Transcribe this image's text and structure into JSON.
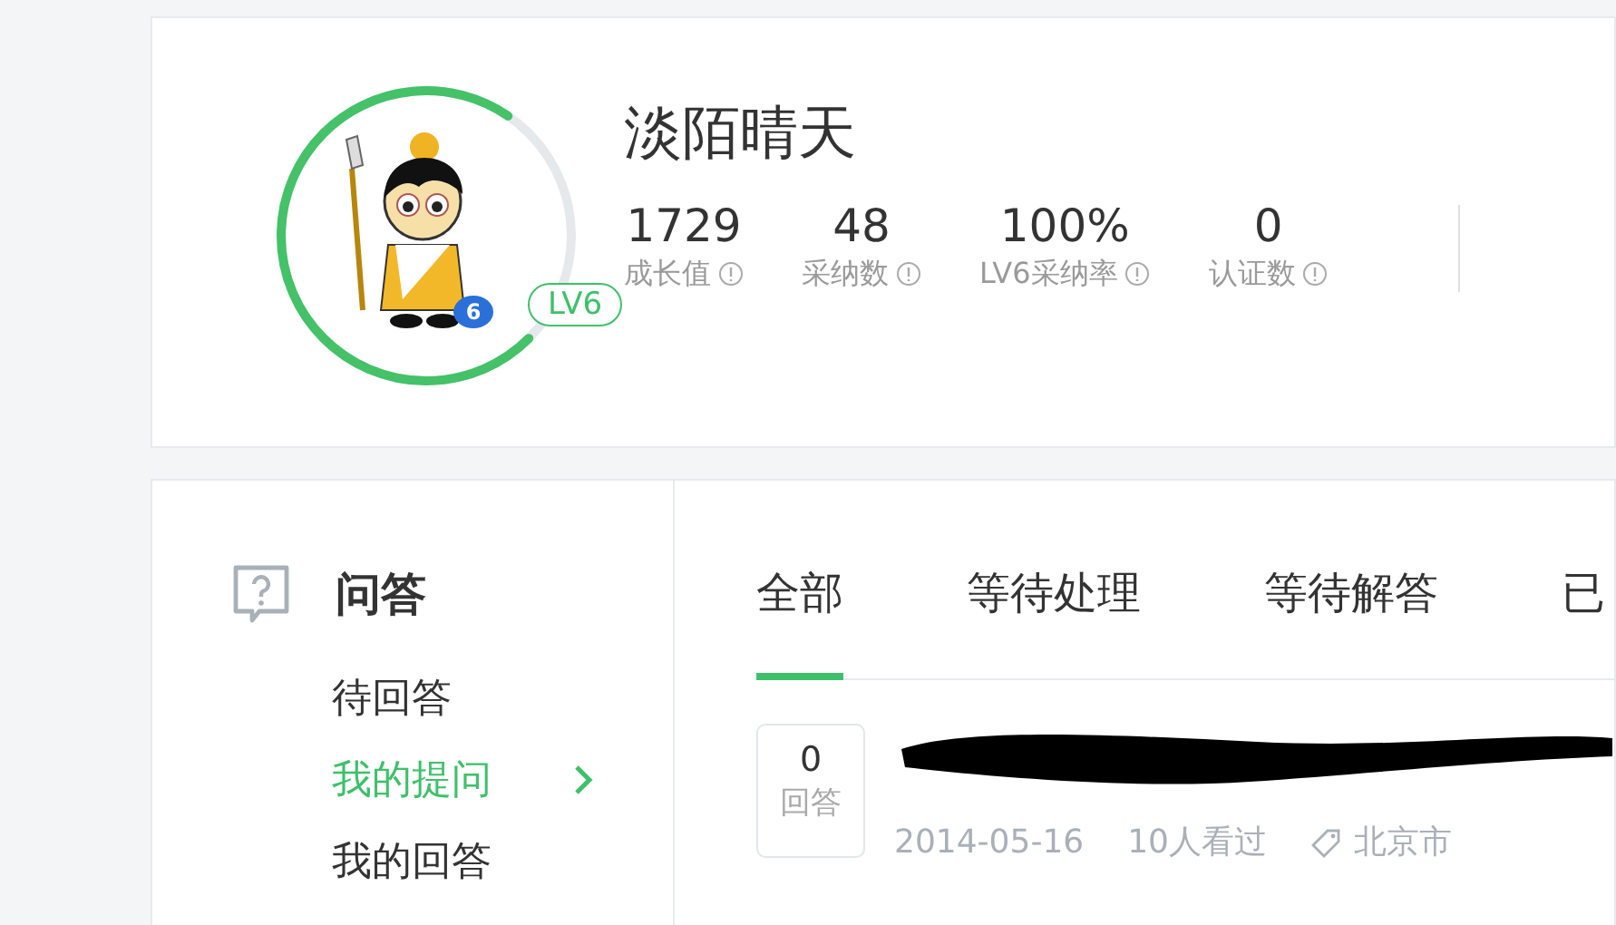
{
  "profile": {
    "name": "淡陌晴天",
    "level_badge": "LV6",
    "avatar_badge": "6",
    "growth_ring": {
      "level": 0.72
    },
    "stats": [
      {
        "value": "1729",
        "label": "成长值"
      },
      {
        "value": "48",
        "label": "采纳数"
      },
      {
        "value": "100%",
        "label": "LV6采纳率"
      },
      {
        "value": "0",
        "label": "认证数"
      }
    ]
  },
  "sidebar": {
    "title": "问答",
    "items": [
      {
        "label": "待回答",
        "selected": false
      },
      {
        "label": "我的提问",
        "selected": true
      },
      {
        "label": "我的回答",
        "selected": false
      }
    ]
  },
  "tabs": [
    {
      "label": "全部",
      "selected": true
    },
    {
      "label": "等待处理",
      "selected": false
    },
    {
      "label": "等待解答",
      "selected": false
    },
    {
      "label": "已",
      "selected": false
    }
  ],
  "questions": [
    {
      "answer_count": "0",
      "answer_label": "回答",
      "title_redacted": true,
      "date": "2014-05-16",
      "views": "10人看过",
      "location": "北京市"
    }
  ]
}
